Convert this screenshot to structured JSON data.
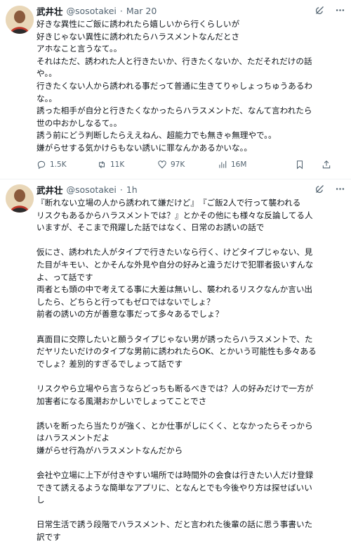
{
  "tweets": [
    {
      "author_name": "武井壮",
      "handle": "@sosotakei",
      "separator": "·",
      "date": "Mar 20",
      "lines": [
        "好きな異性にご飯に誘われたら嬉しいから行くらしいが",
        "好きじゃない異性に誘われたらハラスメントなんだとさ",
        "アホなこと言うなて。。",
        "それはただ、誘われた人と行きたいか、行きたくないか、ただそれだけの話",
        "や。。",
        "行きたくない人から誘われる事だって普通に生きてりゃしょっちゅうあるわ",
        "な。。",
        "誘った相手が自分と行きたくなかったらハラスメントだ、なんて言われたら",
        "世の中おかしなるて。。",
        "誘う前にどう判断したらええねん、超能力でも無きゃ無理やで。。",
        "嫌がらせする気かけらもない誘いに罪なんかあるかいな。。"
      ],
      "stats": {
        "replies": "1.5K",
        "reposts": "11K",
        "likes": "97K",
        "views": "16M"
      },
      "icons": {
        "grok": "grok-icon",
        "more": "more-icon"
      }
    },
    {
      "author_name": "武井壮",
      "handle": "@sosotakei",
      "separator": "·",
      "date": "1h",
      "lines": [
        "『断れない立場の人から誘われて嫌だけど』　『ご飯2人で行って襲われる",
        "リスクもあるからハラスメントでは？』とかその他にも様々な反論してる人",
        "いますが、そこまで飛躍した話ではなく、日常のお誘いの話で",
        "",
        "仮にさ、誘われた人がタイプで行きたいなら行く、けどタイプじゃない、見",
        "た目がキモい、とかそんな外見や自分の好みと違うだけで犯罪者扱いすんな",
        "よ、って話です",
        "両者とも頭の中で考えてる事に大差は無いし、襲われるリスクなんか言い出",
        "したら、どちらと行ってもゼロではないでしょ？",
        "前者の誘いの方が善意な事だって多々あるでしょ？",
        "",
        "真面目に交際したいと願うタイプじゃない男が誘ったらハラスメントで、た",
        "だヤリたいだけのタイプな男前に誘われたらOK、とかいう可能性も多々ある",
        "でしょ？差別的すぎるでしょって話です",
        "",
        "リスクやら立場やら言うならどっちも断るべきでは？人の好みだけで一方が",
        "加害者になる風潮おかしいでしょってことでさ",
        "",
        "誘いを断ったら当たりが強く、とか仕事がしにくく、となかったらそっから",
        "はハラスメントだよ",
        "嫌がらせ行為がハラスメントなんだから",
        "",
        "会社や立場に上下が付きやすい場所では時間外の会食は行きたい人だけ登録",
        "できて誘えるような簡単なアプリに、となんとでも今後やり方は探せばいい",
        "し",
        "",
        "日常生活で誘う段階でハラスメント、だと言われた後輩の話に思う事書いた",
        "訳です"
      ],
      "icons": {
        "grok": "grok-icon",
        "more": "more-icon"
      }
    }
  ]
}
